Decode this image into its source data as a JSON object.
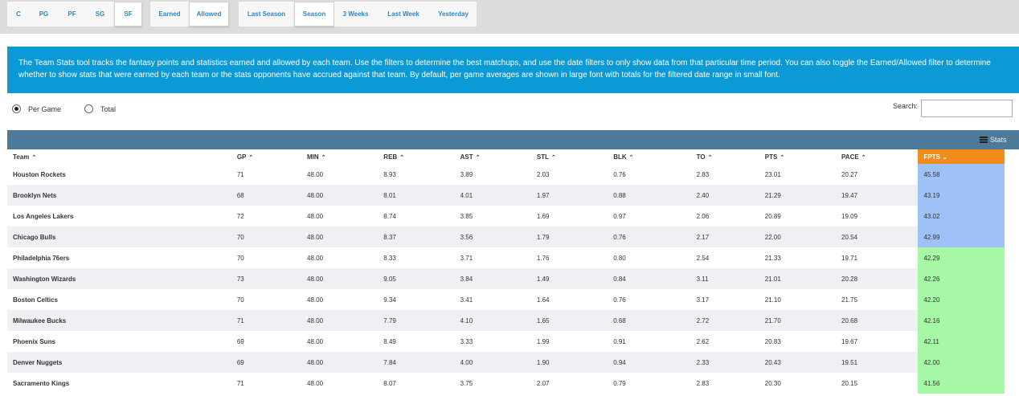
{
  "positions": [
    "C",
    "PG",
    "PF",
    "SG",
    "SF"
  ],
  "mode_buttons": [
    "Earned",
    "Allowed"
  ],
  "range_buttons": [
    "Last Season",
    "Season",
    "3 Weeks",
    "Last Week",
    "Yesterday"
  ],
  "active": {
    "position": "SF",
    "mode": "Allowed",
    "range": "Season"
  },
  "info_text": "The Team Stats tool tracks the fantasy points and statistics earned and allowed by each team. Use the filters to determine the best matchups, and use the date filters to only show data from that particular time period. You can also toggle the Earned/Allowed filter to determine whether to show stats that were earned by each team or the stats opponents have accrued against that team. By default, per game averages are shown in large font with totals for the filtered date range in small font.",
  "view": {
    "per_game": "Per Game",
    "total": "Total",
    "selected": "Per Game"
  },
  "search": {
    "label": "Search:",
    "value": ""
  },
  "stats_toggle": "Stats",
  "columns": [
    "Team",
    "GP",
    "MIN",
    "REB",
    "AST",
    "STL",
    "BLK",
    "TO",
    "PTS",
    "PACE",
    "FPTS"
  ],
  "sort": {
    "column": "FPTS",
    "direction": "desc"
  },
  "rows": [
    [
      "Houston Rockets",
      "71",
      "48.00",
      "8.93",
      "3.89",
      "2.03",
      "0.76",
      "2.83",
      "23.01",
      "20.27",
      "45.58"
    ],
    [
      "Brooklyn Nets",
      "68",
      "48.00",
      "8.01",
      "4.01",
      "1.97",
      "0.88",
      "2.40",
      "21.29",
      "19.47",
      "43.19"
    ],
    [
      "Los Angeles Lakers",
      "72",
      "48.00",
      "8.74",
      "3.85",
      "1.69",
      "0.97",
      "2.06",
      "20.89",
      "19.09",
      "43.02"
    ],
    [
      "Chicago Bulls",
      "70",
      "48.00",
      "8.37",
      "3.56",
      "1.79",
      "0.76",
      "2.17",
      "22.00",
      "20.54",
      "42.99"
    ],
    [
      "Philadelphia 76ers",
      "70",
      "48.00",
      "8.33",
      "3.71",
      "1.76",
      "0.80",
      "2.54",
      "21.33",
      "19.71",
      "42.29"
    ],
    [
      "Washington Wizards",
      "73",
      "48.00",
      "9.05",
      "3.84",
      "1.49",
      "0.84",
      "3.11",
      "21.01",
      "20.28",
      "42.26"
    ],
    [
      "Boston Celtics",
      "70",
      "48.00",
      "9.34",
      "3.41",
      "1.64",
      "0.76",
      "3.17",
      "21.10",
      "21.75",
      "42.20"
    ],
    [
      "Milwaukee Bucks",
      "71",
      "48.00",
      "7.79",
      "4.10",
      "1.65",
      "0.68",
      "2.72",
      "21.70",
      "20.68",
      "42.16"
    ],
    [
      "Phoenix Suns",
      "69",
      "48.00",
      "8.49",
      "3.33",
      "1.99",
      "0.91",
      "2.62",
      "20.83",
      "19.67",
      "42.11"
    ],
    [
      "Denver Nuggets",
      "69",
      "48.00",
      "7.84",
      "4.00",
      "1.90",
      "0.94",
      "2.33",
      "20.43",
      "19.51",
      "42.00"
    ],
    [
      "Sacramento Kings",
      "71",
      "48.00",
      "8.07",
      "3.75",
      "2.07",
      "0.79",
      "2.83",
      "20.30",
      "20.15",
      "41.56"
    ]
  ],
  "fpts_highlight": [
    "blue",
    "blue",
    "blue",
    "blue",
    "green",
    "green",
    "green",
    "green",
    "green",
    "green",
    "green"
  ],
  "colors": {
    "info_bg": "#0b9ad6",
    "table_header_bg": "#4d7a98",
    "sort_header_bg": "#f28c1a",
    "fpts_blue": "#9ec2f7",
    "fpts_green": "#a6f7a6",
    "button_text": "#2a86c8"
  }
}
